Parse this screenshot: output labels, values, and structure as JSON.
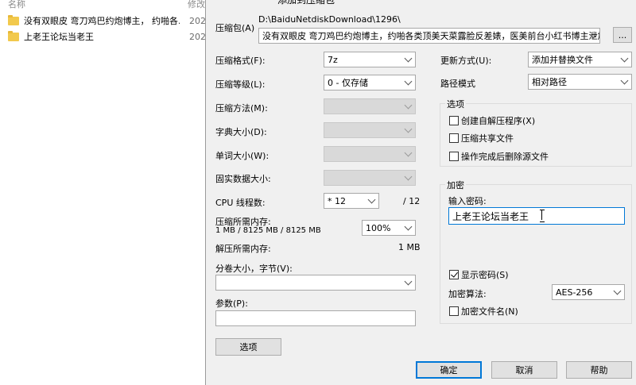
{
  "explorer": {
    "col_name": "名称",
    "col_date": "修改",
    "rows": [
      {
        "name": "没有双眼皮 弯刀鸡巴约炮博主，  约啪各...",
        "date": "202"
      },
      {
        "name": "上老王论坛当老王",
        "date": "202"
      }
    ]
  },
  "dialog": {
    "title": "添加到压缩包",
    "archive_label": "压缩包(A)",
    "archive_path": "D:\\BaiduNetdiskDownload\\1296\\",
    "archive_name": "没有双眼皮 弯刀鸡巴约炮博主，约啪各类顶美天菜露脸反差婊，医美前台小红书博主泄加",
    "browse_label": "...",
    "format_label": "压缩格式(F):",
    "format_value": "7z",
    "level_label": "压缩等级(L):",
    "level_value": "0 - 仅存储",
    "method_label": "压缩方法(M):",
    "dict_label": "字典大小(D):",
    "word_label": "单词大小(W):",
    "solid_label": "固实数据大小:",
    "cpu_label": "CPU 线程数:",
    "cpu_value": "* 12",
    "cpu_max": "/ 12",
    "mem_comp_label": "压缩所需内存:",
    "mem_comp_value": "1 MB / 8125 MB / 8125 MB",
    "mem_percent": "100%",
    "mem_decomp_label": "解压所需内存:",
    "mem_decomp_value": "1 MB",
    "volume_label": "分卷大小，字节(V):",
    "volume_value": "",
    "params_label": "参数(P):",
    "params_value": "",
    "options_button": "选项",
    "update_label": "更新方式(U):",
    "update_value": "添加并替换文件",
    "path_label": "路径模式",
    "path_value": "相对路径",
    "options_group": "选项",
    "opt_sfx": "创建自解压程序(X)",
    "opt_shared": "压缩共享文件",
    "opt_delete": "操作完成后删除源文件",
    "encrypt_group": "加密",
    "password_label": "输入密码:",
    "password_value": "上老王论坛当老王",
    "show_password": "显示密码(S)",
    "enc_method_label": "加密算法:",
    "enc_method_value": "AES-256",
    "enc_names": "加密文件名(N)",
    "ok_button": "确定",
    "cancel_button": "取消",
    "help_button": "帮助"
  }
}
